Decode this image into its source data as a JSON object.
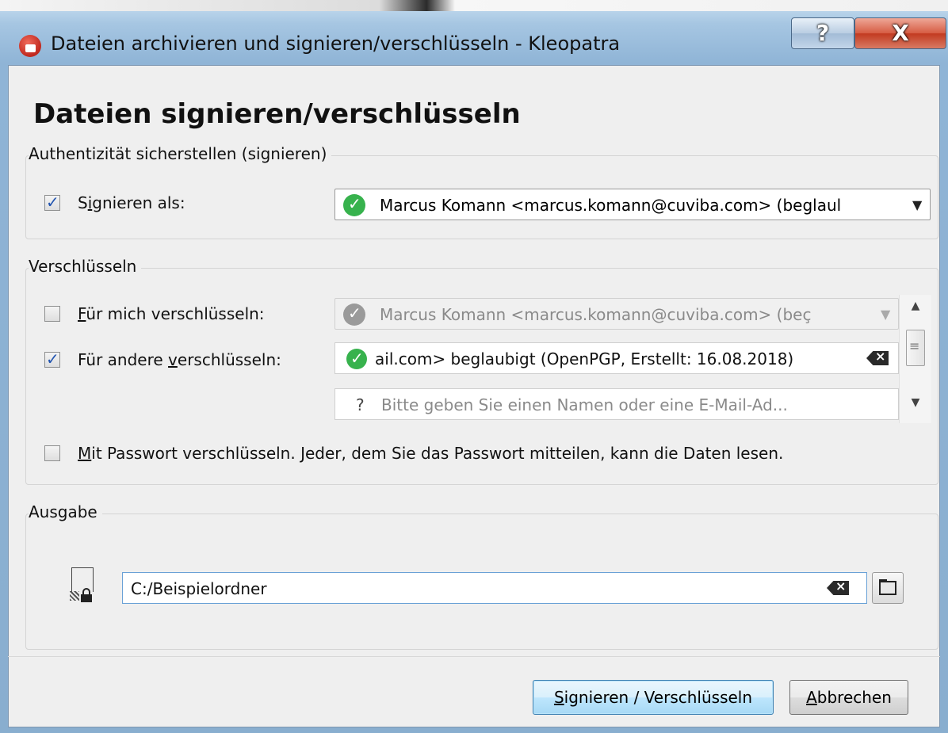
{
  "window": {
    "title": "Dateien archivieren und signieren/verschlüsseln - Kleopatra",
    "help_label": "?",
    "close_label": "X"
  },
  "heading": "Dateien signieren/verschlüsseln",
  "sign_group": {
    "legend": "Authentizität sicherstellen (signieren)",
    "sign_as": {
      "checked": true,
      "label_pre": "S",
      "label_accel": "i",
      "label_post": "gnieren als:",
      "value": "Marcus Komann <marcus.komann@cuviba.com> (beglaul",
      "arrow": "▼"
    }
  },
  "encrypt_group": {
    "legend": "Verschlüsseln",
    "for_me": {
      "checked": false,
      "label_accel": "F",
      "label_post": "ür mich verschlüsseln:",
      "value": "Marcus Komann <marcus.komann@cuviba.com> (beç",
      "arrow": "▼",
      "disabled": true
    },
    "for_others": {
      "checked": true,
      "label_pre": "Für andere ",
      "label_accel": "v",
      "label_post": "erschlüsseln:",
      "recipients": [
        {
          "value": "ail.com> beglaubigt (OpenPGP, Erstellt: 16.08.2018)",
          "status": "valid"
        }
      ],
      "new_recipient_placeholder": "Bitte geben Sie einen Namen oder eine E-Mail-Ad...",
      "unknown_glyph": "?"
    },
    "scroll": {
      "up": "▲",
      "down": "▼",
      "grip": "≡"
    },
    "password": {
      "checked": false,
      "label_accel": "M",
      "label_post": "it Passwort verschlüsseln. Jeder, dem Sie das Passwort mitteilen, kann die Daten lesen."
    }
  },
  "output_group": {
    "legend": "Ausgabe",
    "path": "C:/Beispielordner"
  },
  "buttons": {
    "ok_accel": "S",
    "ok_rest": "ignieren / Verschlüsseln",
    "cancel_accel": "A",
    "cancel_rest": "bbrechen"
  },
  "colors": {
    "valid_badge": "#37b24d",
    "accent": "#2255b0"
  }
}
